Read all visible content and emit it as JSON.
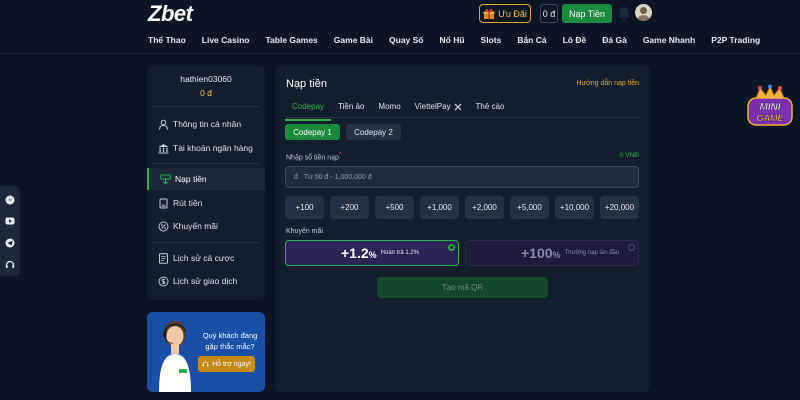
{
  "header": {
    "logo": "Zbet",
    "promo_label": "Ưu Đãi",
    "balance": "0 đ",
    "deposit_label": "Nạp Tiền"
  },
  "nav": [
    "Thể Thao",
    "Live Casino",
    "Table Games",
    "Game Bài",
    "Quay Số",
    "Nổ Hũ",
    "Slots",
    "Bắn Cá",
    "Lô Đề",
    "Đá Gà",
    "Game Nhanh",
    "P2P Trading"
  ],
  "sidebar": {
    "username": "hathien03060",
    "balance": "0 đ",
    "items": [
      {
        "label": "Thông tin cá nhân",
        "icon": "user-icon"
      },
      {
        "label": "Tài khoản ngân hàng",
        "icon": "bank-icon"
      },
      {
        "label": "Nạp tiền",
        "icon": "deposit-icon",
        "active": true
      },
      {
        "label": "Rút tiền",
        "icon": "withdraw-icon"
      },
      {
        "label": "Khuyến mãi",
        "icon": "promo-icon"
      },
      {
        "label": "Lịch sử cá cược",
        "icon": "bet-history-icon"
      },
      {
        "label": "Lịch sử giao dịch",
        "icon": "transaction-history-icon"
      }
    ],
    "support": {
      "question": "Quý khách đang gặp thắc mắc?",
      "help_label": "Hỗ trợ ngay!"
    }
  },
  "main": {
    "title": "Nạp tiền",
    "guide_link": "Hướng dẫn nạp tiền",
    "tabs": [
      "Codepay",
      "Tiền ảo",
      "Momo",
      "ViettelPay",
      "Thẻ cào"
    ],
    "sub_tabs": [
      "Codepay 1",
      "Codepay 2"
    ],
    "amount_label": "Nhập số tiền nạp",
    "amount_required": "*",
    "amount_min": "0 VNĐ",
    "currency_symbol": "đ",
    "amount_placeholder": "Từ 50 đ - 1,000,000 đ",
    "quick_amounts": [
      "+100",
      "+200",
      "+500",
      "+1,000",
      "+2,000",
      "+5,000",
      "+10,000",
      "+20,000"
    ],
    "promo_label": "Khuyến mãi",
    "promos": [
      {
        "value": "+1.2",
        "suffix": "%",
        "desc": "Hoàn trả 1.2%",
        "selected": true
      },
      {
        "value": "+100",
        "suffix": "%",
        "desc": "Thưởng nạp lần đầu",
        "selected": false
      }
    ],
    "qr_button": "Tạo mã QR"
  },
  "minigame": {
    "line1": "MINI",
    "line2": "GAME"
  },
  "colors": {
    "accent": "#28b24a",
    "gold": "#e3a72a",
    "bg": "#0b1523",
    "panel": "#131e2c"
  }
}
